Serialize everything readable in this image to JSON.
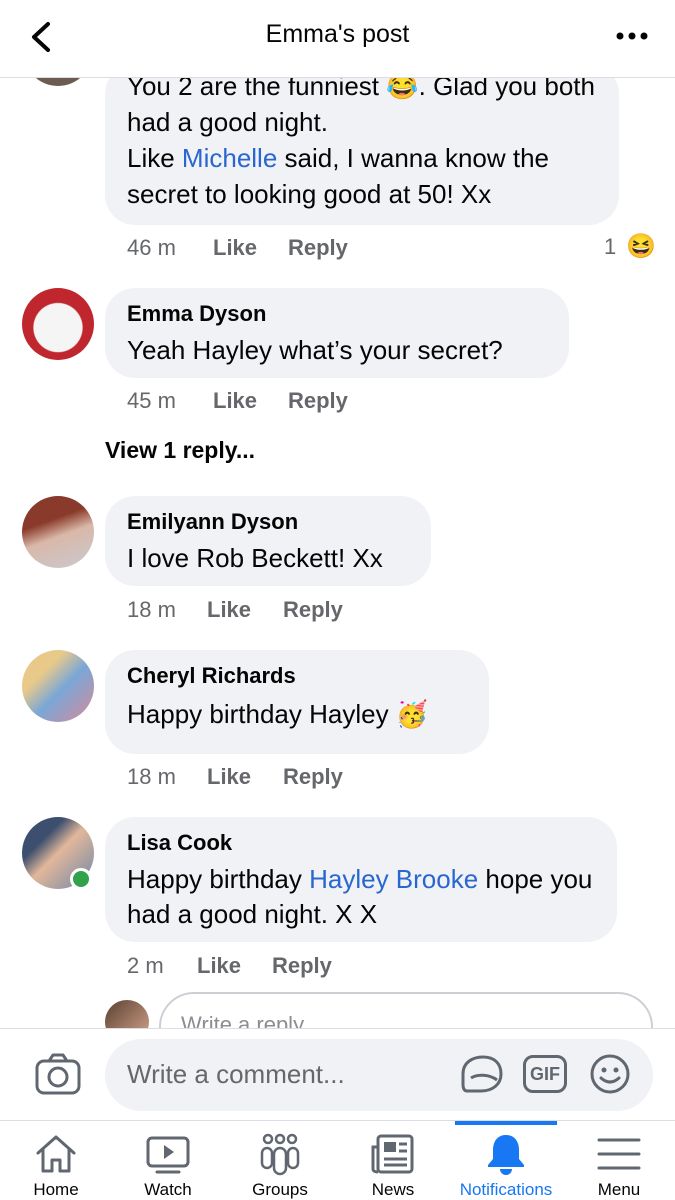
{
  "header": {
    "title": "Emma's post"
  },
  "comments": [
    {
      "text_parts": [
        "You 2 are the funniest ",
        "😂",
        ". Glad you both had a good night.",
        "Like ",
        "Michelle",
        " said, I wanna know the secret to looking good at 50! Xx"
      ],
      "time": "46 m",
      "like": "Like",
      "reply": "Reply",
      "reaction_count": "1",
      "reaction_emoji": "😆"
    },
    {
      "name": "Emma Dyson",
      "text": "Yeah Hayley what’s your secret?",
      "time": "45 m",
      "like": "Like",
      "reply": "Reply"
    },
    {
      "name": "Emilyann Dyson",
      "text": "I love Rob Beckett! Xx",
      "time": "18 m",
      "like": "Like",
      "reply": "Reply"
    },
    {
      "name": "Cheryl Richards",
      "text": "Happy birthday Hayley",
      "emoji": "🥳",
      "time": "18 m",
      "like": "Like",
      "reply": "Reply"
    },
    {
      "name": "Lisa Cook",
      "text_parts": [
        "Happy birthday ",
        "Hayley Brooke",
        " hope you had a good night. X X"
      ],
      "time": "2 m",
      "like": "Like",
      "reply": "Reply"
    }
  ],
  "view_replies": "View 1 reply...",
  "reply_placeholder": "Write a reply...",
  "composer": {
    "placeholder": "Write a comment...",
    "gif_label": "GIF"
  },
  "tabs": [
    {
      "label": "Home",
      "icon": "home-icon"
    },
    {
      "label": "Watch",
      "icon": "watch-icon"
    },
    {
      "label": "Groups",
      "icon": "groups-icon"
    },
    {
      "label": "News",
      "icon": "news-icon"
    },
    {
      "label": "Notifications",
      "icon": "bell-icon",
      "active": true
    },
    {
      "label": "Menu",
      "icon": "menu-icon"
    }
  ],
  "colors": {
    "accent": "#1877f2",
    "link": "#2a66d0",
    "bubble": "#f0f2f5",
    "muted": "#65676b"
  }
}
